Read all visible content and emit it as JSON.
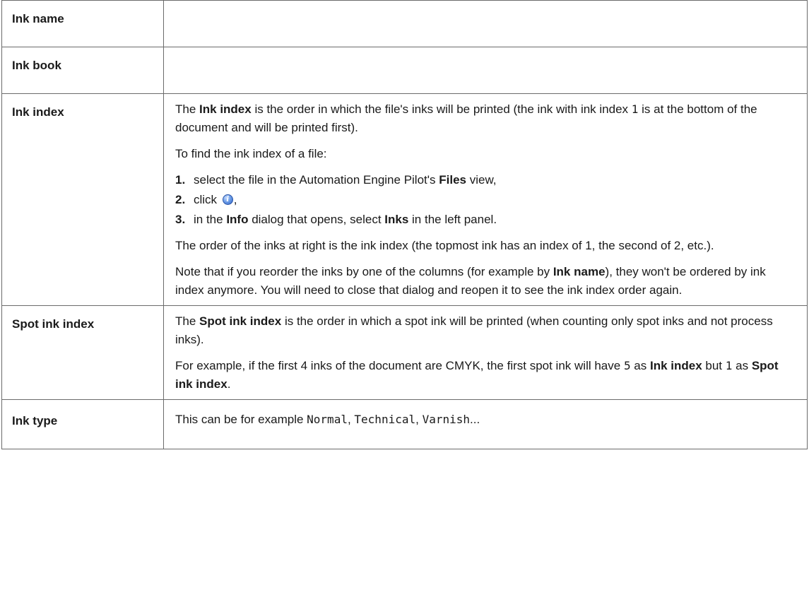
{
  "rows": {
    "ink_name": {
      "label": "Ink name"
    },
    "ink_book": {
      "label": "Ink book"
    },
    "ink_index": {
      "label": "Ink index",
      "p1": {
        "t1": "The ",
        "b1": "Ink index",
        "t2": " is the order in which the file's inks will be printed (the ink with ink index ",
        "code1": "1",
        "t3": " is at the bottom of the document and will be printed first)."
      },
      "p2": "To find the ink index of a file:",
      "steps": [
        {
          "num": "1.",
          "t1": "select the file in the Automation Engine Pilot's ",
          "b1": "Files",
          "t2": " view,"
        },
        {
          "num": "2.",
          "t1": "click ",
          "icon": "info-icon",
          "t2": ","
        },
        {
          "num": "3.",
          "t1": "in the ",
          "b1": "Info",
          "t2": " dialog that opens, select ",
          "b2": "Inks",
          "t3": " in the left panel."
        }
      ],
      "p3": "The order of the inks at right is the ink index (the topmost ink has an index of 1, the second of 2, etc.).",
      "p4": {
        "t1": "Note that if you reorder the inks by one of the columns (for example by ",
        "b1": "Ink name",
        "t2": "), they won't be ordered by ink index anymore. You will need to close that dialog and reopen it to see the ink index order again."
      }
    },
    "spot_ink_index": {
      "label": "Spot ink index",
      "p1": {
        "t1": "The ",
        "b1": "Spot ink index",
        "t2": " is the order in which a spot ink will be printed (when counting only spot inks and not process inks)."
      },
      "p2": {
        "t1": "For example, if the first 4 inks of the document are CMYK, the first spot ink will have ",
        "code1": "5",
        "t2": " as ",
        "b1": "Ink index",
        "t3": " but ",
        "code2": "1",
        "t4": " as ",
        "b2": "Spot ink index",
        "t5": "."
      }
    },
    "ink_type": {
      "label": "Ink type",
      "p1": {
        "t1": "This can be for example ",
        "code1": "Normal",
        "t2": ", ",
        "code2": "Technical",
        "t3": ", ",
        "code3": "Varnish",
        "t4": "..."
      }
    }
  }
}
